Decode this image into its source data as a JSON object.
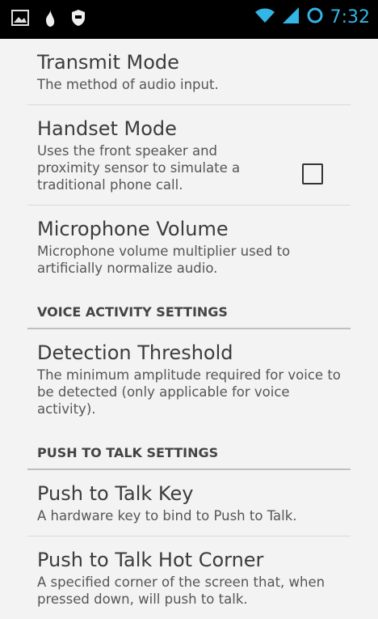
{
  "status_bar": {
    "time": "7:32",
    "left_icons": [
      "picture-icon",
      "flame-icon",
      "shield-icon"
    ],
    "right_icons": [
      "wifi-icon",
      "signal-icon",
      "battery-icon"
    ],
    "accent": "#33b5e5"
  },
  "preferences": [
    {
      "title": "Transmit Mode",
      "summary": "The method of audio input."
    },
    {
      "title": "Handset Mode",
      "summary": "Uses the front speaker and proximity sensor to simulate a traditional phone call.",
      "checked": false
    },
    {
      "title": "Microphone Volume",
      "summary": "Microphone volume multiplier used to artificially normalize audio."
    }
  ],
  "categories": {
    "voice_activity": "VOICE ACTIVITY SETTINGS",
    "push_to_talk": "PUSH TO TALK SETTINGS"
  },
  "voice_activity_prefs": [
    {
      "title": "Detection Threshold",
      "summary": "The minimum amplitude required for voice to be detected (only applicable for voice activity)."
    }
  ],
  "push_to_talk_prefs": [
    {
      "title": "Push to Talk Key",
      "summary": "A hardware key to bind to Push to Talk."
    },
    {
      "title": "Push to Talk Hot Corner",
      "summary": "A specified corner of the screen that, when pressed down, will push to talk."
    }
  ]
}
